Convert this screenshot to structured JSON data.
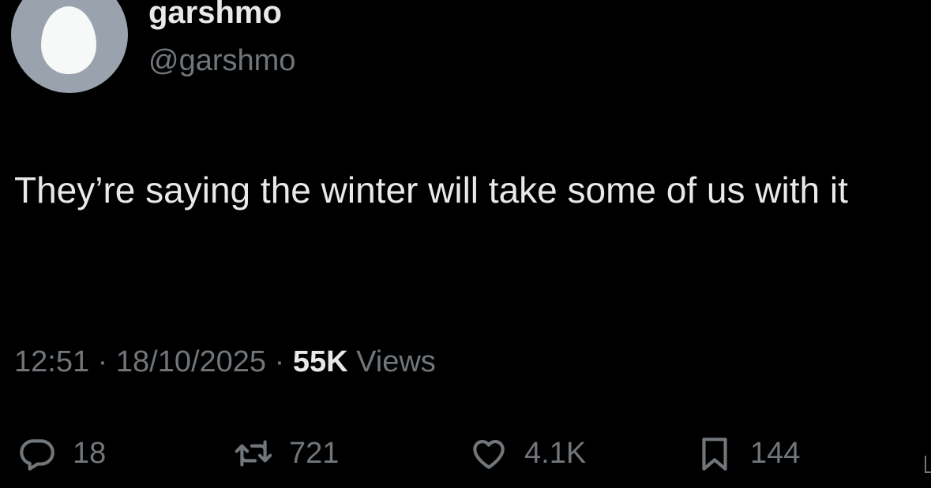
{
  "author": {
    "display_name": "garshmo",
    "handle": "@garshmo",
    "avatar_icon": "default-egg-avatar-icon",
    "avatar_color": "#9aa3ad"
  },
  "tweet": {
    "text": "They’re saying the winter will take some of us with it"
  },
  "meta": {
    "time": "12:51",
    "separator": "·",
    "date": "18/10/2025",
    "views_count": "55K",
    "views_label": "Views"
  },
  "actions": {
    "reply": {
      "icon": "reply-bubble-icon",
      "count": "18"
    },
    "retweet": {
      "icon": "retweet-icon",
      "count": "721"
    },
    "like": {
      "icon": "heart-icon",
      "count": "4.1K"
    },
    "bookmark": {
      "icon": "bookmark-icon",
      "count": "144"
    }
  },
  "colors": {
    "background": "#000000",
    "primary_text": "#e7e9ea",
    "secondary_text": "#71767b"
  }
}
